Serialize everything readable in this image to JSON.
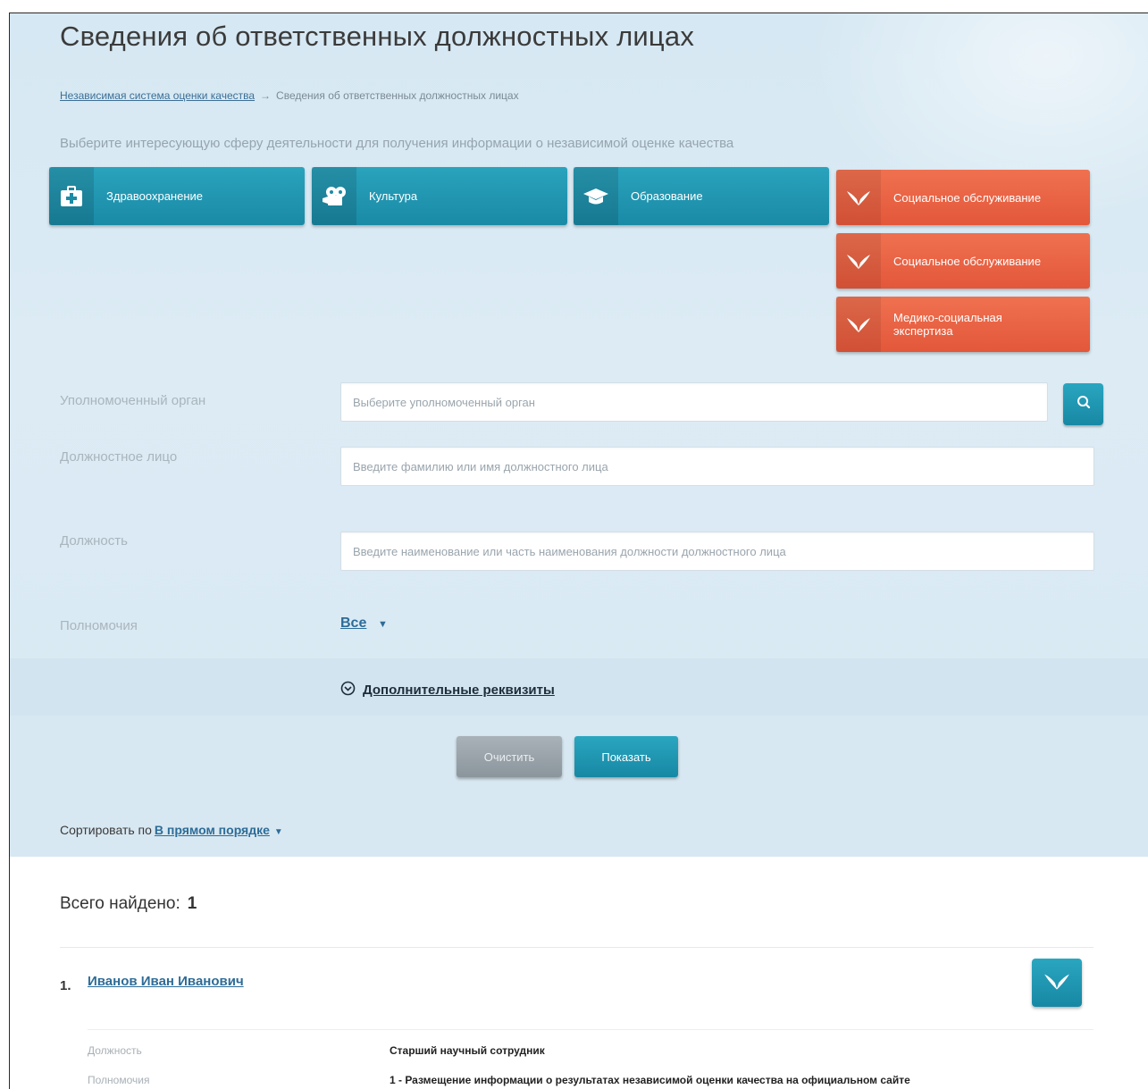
{
  "page": {
    "title": "Сведения об ответственных должностных лицах",
    "breadcrumb": {
      "link": "Независимая система оценки качества",
      "separator": "→",
      "current": "Сведения об ответственных должностных лицах"
    },
    "hint": "Выберите интересующую сферу деятельности для получения информации о независимой оценке качества"
  },
  "spheres": [
    {
      "label": "Здравоохранение",
      "icon": "medical-kit-icon",
      "color": "#1f93ae"
    },
    {
      "label": "Культура",
      "icon": "theater-icon",
      "color": "#1f93ae"
    },
    {
      "label": "Образование",
      "icon": "graduation-cap-icon",
      "color": "#1f93ae"
    },
    {
      "label": "Социальное обслуживание",
      "icon": "hands-icon",
      "color": "#e8603f"
    },
    {
      "label": "Социальное обслуживание",
      "icon": "hands-icon",
      "color": "#e8603f"
    },
    {
      "label": "Медико-социальная экспертиза",
      "icon": "hands-icon",
      "color": "#e8603f"
    }
  ],
  "form": {
    "authority": {
      "label": "Уполномоченный орган",
      "placeholder": "Выберите уполномоченный орган"
    },
    "official": {
      "label": "Должностное лицо",
      "placeholder": "Введите фамилию или имя должностного лица"
    },
    "position": {
      "label": "Должность",
      "placeholder": "Введите наименование или часть наименования должности должностного лица"
    },
    "powers": {
      "label": "Полномочия",
      "value": "Все"
    },
    "extra_link": "Дополнительные реквизиты",
    "clear_label": "Очистить",
    "show_label": "Показать"
  },
  "sort": {
    "label": "Сортировать по",
    "value": "В прямом порядке"
  },
  "results": {
    "found_label": "Всего найдено:",
    "found_count": "1",
    "items": [
      {
        "num": "1.",
        "name": "Иванов Иван Иванович",
        "position_label": "Должность",
        "position_value": "Старший научный сотрудник",
        "powers_label": "Полномочия",
        "powers_value": "1 - Размещение информации о результатах независимой оценки качества на официальном сайте"
      }
    ]
  }
}
